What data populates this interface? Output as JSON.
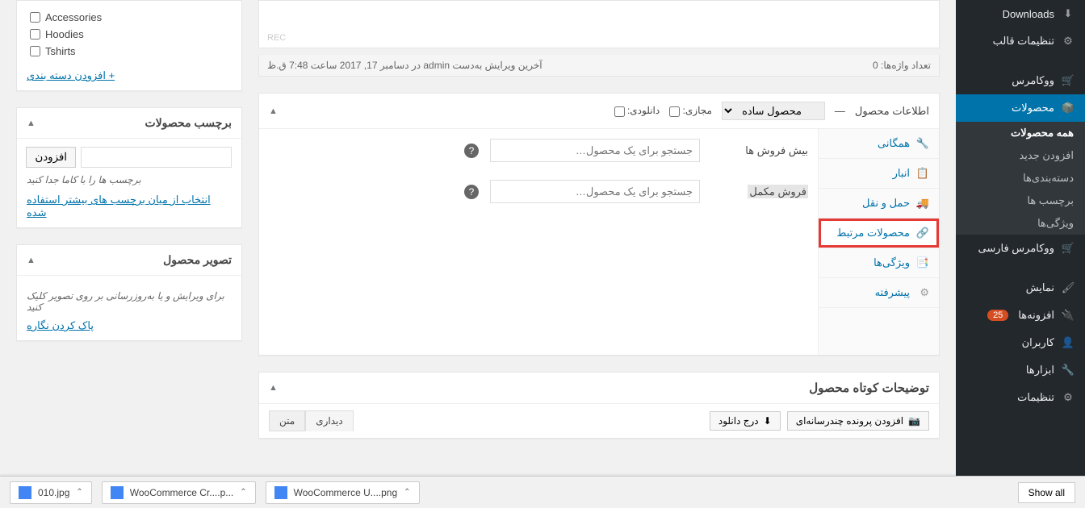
{
  "sidebar": {
    "items": [
      {
        "label": "Downloads",
        "icon": "download"
      },
      {
        "label": "تنظیمات قالب",
        "icon": "cog"
      },
      {
        "label": "ووکامرس",
        "icon": "woo"
      },
      {
        "label": "محصولات",
        "icon": "box",
        "active": true
      },
      {
        "label": "ووکامرس فارسی",
        "icon": "woo"
      },
      {
        "label": "نمایش",
        "icon": "brush"
      },
      {
        "label": "افزونه‌ها",
        "icon": "plug",
        "badge": "25"
      },
      {
        "label": "کاربران",
        "icon": "users"
      },
      {
        "label": "ابزارها",
        "icon": "wrench"
      },
      {
        "label": "تنظیمات",
        "icon": "slider"
      }
    ],
    "submenu": [
      {
        "label": "همه محصولات",
        "current": true
      },
      {
        "label": "افزودن جدید"
      },
      {
        "label": "دسته‌بندی‌ها"
      },
      {
        "label": "برچسب ها"
      },
      {
        "label": "ویژگی‌ها"
      }
    ]
  },
  "editor_status": {
    "word_count_label": "تعداد واژه‌ها: 0",
    "last_edit": "آخرین ویرایش به‌دست admin در دسامبر 17, 2017 ساعت 7:48 ق.ظ"
  },
  "product_data": {
    "title": "اطلاعات محصول",
    "dash": "—",
    "type_selected": "محصول ساده",
    "virtual_label": "مجازی:",
    "downloadable_label": "دانلودی:",
    "tabs": [
      {
        "label": "همگانی",
        "icon": "wrench"
      },
      {
        "label": "انبار",
        "icon": "clipboard"
      },
      {
        "label": "حمل و نقل",
        "icon": "truck"
      },
      {
        "label": "محصولات مرتبط",
        "icon": "link",
        "highlighted": true,
        "active": true
      },
      {
        "label": "ویژگی‌ها",
        "icon": "list"
      },
      {
        "label": "پیشرفته",
        "icon": "cog"
      }
    ],
    "panel": {
      "upsell_label": "بیش فروش ها",
      "crosssell_label": "فروش مکمل",
      "search_placeholder": "جستجو برای یک محصول…"
    }
  },
  "short_desc": {
    "title": "توضیحات کوتاه محصول",
    "add_media": "افزودن پرونده چندرسانه‌ای",
    "insert_download": "درج دانلود",
    "tab_visual": "دیداری",
    "tab_text": "متن"
  },
  "categories": {
    "items": [
      "Accessories",
      "Hoodies",
      "Tshirts"
    ],
    "add_link": "+ افزودن دسته بندی"
  },
  "tags": {
    "title": "برچسب محصولات",
    "add_btn": "افزودن",
    "hint": "برچسب ها را با کاما جدا کنید",
    "choose_link": "انتخاب از میان برچسب های بیشتر استفاده شده"
  },
  "image_box": {
    "title": "تصویر محصول",
    "hint": "برای ویرایش و یا به‌روزرسانی بر روی تصویر کلیک کنید",
    "remove_link": "پاک کردن نگاره"
  },
  "downloads_bar": {
    "files": [
      {
        "name": "010.jpg"
      },
      {
        "name": "WooCommerce Cr....p..."
      },
      {
        "name": "WooCommerce U....png"
      }
    ],
    "show_all": "Show all"
  }
}
